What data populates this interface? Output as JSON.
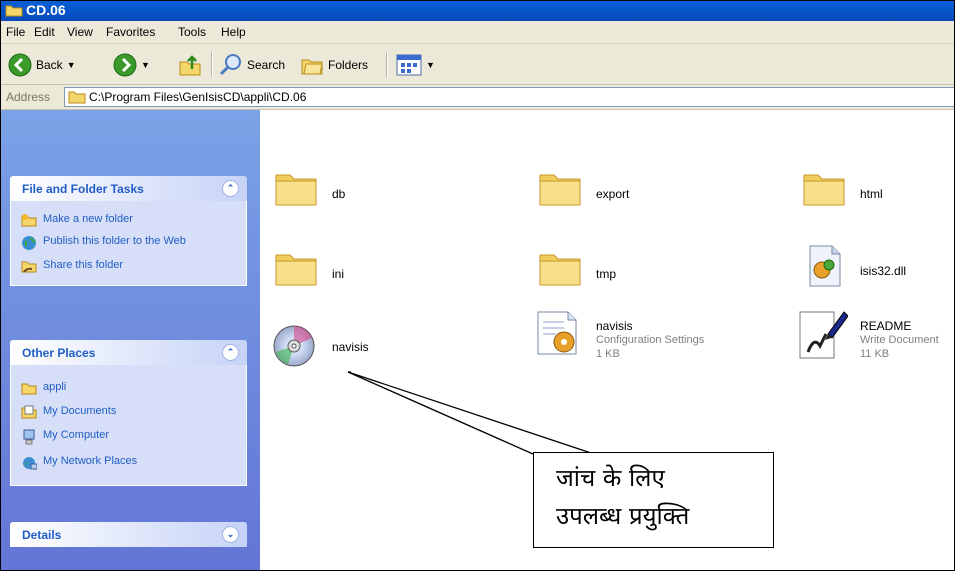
{
  "window": {
    "title": "CD.06"
  },
  "menu": [
    "File",
    "Edit",
    "View",
    "Favorites",
    "Tools",
    "Help"
  ],
  "toolbar": {
    "back": "Back",
    "search": "Search",
    "folders": "Folders"
  },
  "address": {
    "label": "Address",
    "path": "C:\\Program Files\\GenIsisCD\\appli\\CD.06"
  },
  "tasks": {
    "title": "File and Folder Tasks",
    "items": [
      "Make a new folder",
      "Publish this folder to the Web",
      "Share this folder"
    ]
  },
  "places": {
    "title": "Other Places",
    "items": [
      "appli",
      "My Documents",
      "My Computer",
      "My Network Places"
    ]
  },
  "details": {
    "title": "Details"
  },
  "files": [
    {
      "name": "db"
    },
    {
      "name": "export"
    },
    {
      "name": "html"
    },
    {
      "name": "ini"
    },
    {
      "name": "tmp"
    },
    {
      "name": "isis32.dll"
    },
    {
      "name": "navisis"
    },
    {
      "name": "navisis",
      "type": "Configuration Settings",
      "size": "1 KB"
    },
    {
      "name": "README",
      "type": "Write Document",
      "size": "11 KB"
    }
  ],
  "annotation": {
    "line1": "जांच के लिए",
    "line2": "उपलब्ध प्रयुक्ति"
  },
  "colors": {
    "titlebar": "#0a5fd8",
    "leftpane": "#7ba2e7",
    "link": "#215dc6"
  }
}
